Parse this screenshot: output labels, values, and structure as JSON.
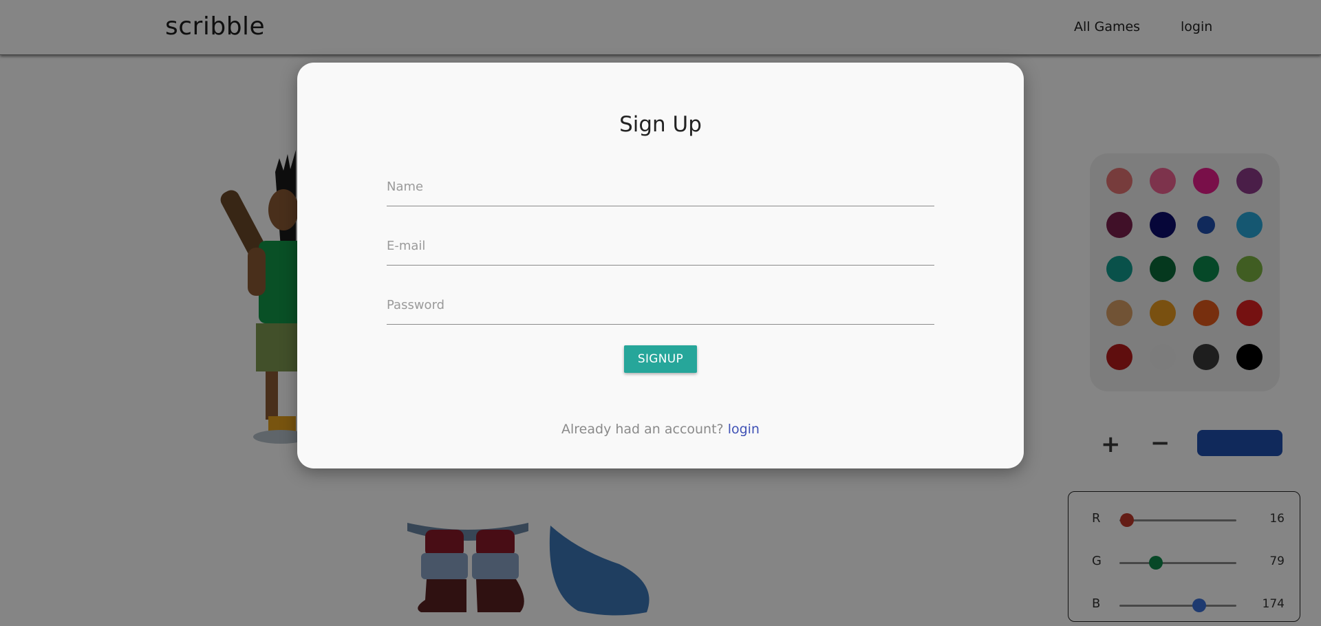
{
  "header": {
    "brand": "scribble",
    "nav": [
      {
        "label": "All Games"
      },
      {
        "label": "login"
      }
    ]
  },
  "palette": {
    "swatches": [
      "#e57373",
      "#f06292",
      "#e91e8c",
      "#8e3a8a",
      "#7b1f4d",
      "#0d0d6e",
      "#1f4fae",
      "#29a8d8",
      "#139c8f",
      "#0a6b3a",
      "#0d8a4e",
      "#7cb342",
      "#d9a066",
      "#e89a1f",
      "#e55a1c",
      "#e02222",
      "#b71c1c",
      "#eeeeee",
      "#3a3a3a",
      "#000000"
    ],
    "selected_index": 6
  },
  "brush": {
    "increase_label": "+",
    "decrease_label": "−",
    "current_color": "#1f4fae"
  },
  "rgb": {
    "r": {
      "label": "R",
      "value": "16",
      "fraction": 0.063,
      "color": "#c0392b"
    },
    "g": {
      "label": "G",
      "value": "79",
      "fraction": 0.31,
      "color": "#0f8a4c"
    },
    "b": {
      "label": "B",
      "value": "174",
      "fraction": 0.682,
      "color": "#3b6fd6"
    }
  },
  "modal": {
    "title": "Sign Up",
    "fields": {
      "name": {
        "placeholder": "Name",
        "value": ""
      },
      "email": {
        "placeholder": "E-mail",
        "value": ""
      },
      "password": {
        "placeholder": "Password",
        "value": ""
      }
    },
    "submit_label": "SIGNUP",
    "footer_prompt": "Already had an account?",
    "footer_link": "login"
  }
}
